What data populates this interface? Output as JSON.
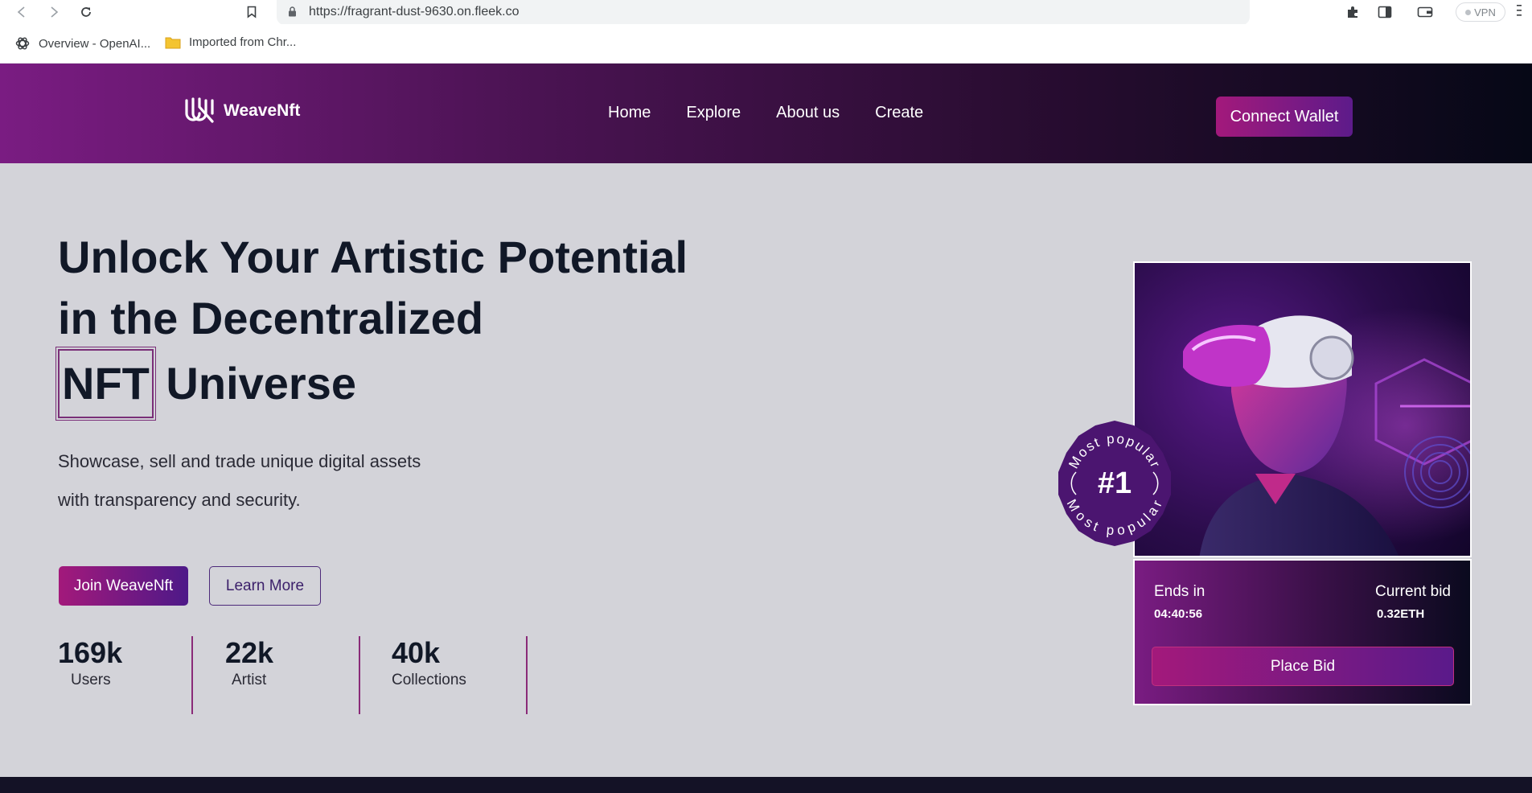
{
  "browser": {
    "url": "https://fragrant-dust-9630.on.fleek.co",
    "vpn_label": "VPN",
    "bookmarks": [
      {
        "label": "Overview - OpenAI..."
      },
      {
        "label": "Imported from Chr..."
      }
    ]
  },
  "site": {
    "brand": "WeaveNft",
    "nav": [
      "Home",
      "Explore",
      "About us",
      "Create"
    ],
    "connect_label": "Connect Wallet"
  },
  "hero": {
    "title_line1": "Unlock Your Artistic Potential",
    "title_line2": "in the Decentralized",
    "title_highlight": "NFT",
    "title_end": "Universe",
    "subtitle_line1": "Showcase, sell and trade unique digital assets",
    "subtitle_line2": "with transparency and security.",
    "join_label": "Join WeaveNft",
    "learn_label": "Learn More"
  },
  "stats": [
    {
      "value": "169k",
      "label": "Users"
    },
    {
      "value": "22k",
      "label": "Artist"
    },
    {
      "value": "40k",
      "label": "Collections"
    }
  ],
  "card": {
    "badge_text": "Most popular",
    "badge_rank": "#1",
    "ends_label": "Ends in",
    "ends_value": "04:40:56",
    "bid_label": "Current bid",
    "bid_value": "0.32ETH",
    "place_bid_label": "Place Bid"
  },
  "colors": {
    "accent_magenta": "#a3197b",
    "accent_purple": "#5d1b8a",
    "background": "#d3d3d9"
  }
}
